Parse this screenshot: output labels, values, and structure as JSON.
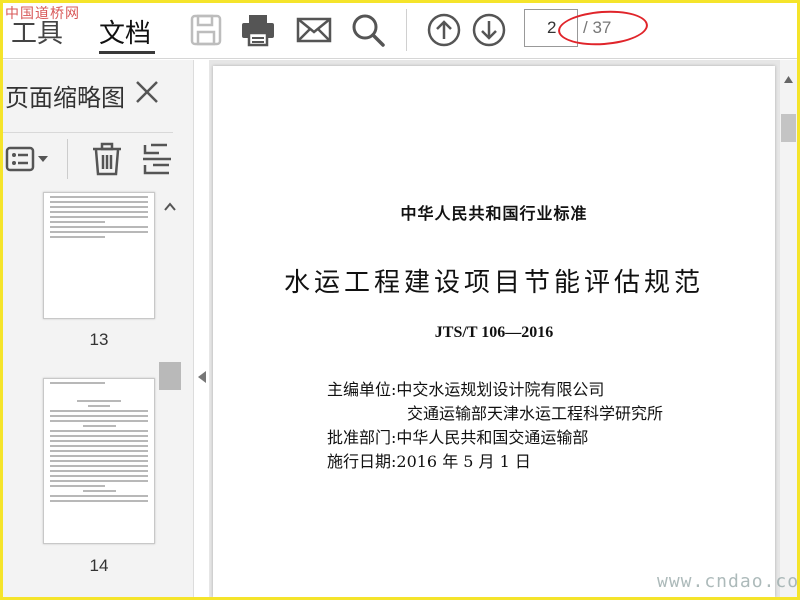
{
  "watermarks": {
    "top_left": "中国道桥网",
    "bottom_right": "www.cndao.com"
  },
  "toolbar": {
    "menu": [
      "工具",
      "文档"
    ],
    "active_menu": "文档",
    "icons": [
      "save-icon",
      "print-icon",
      "email-icon",
      "search-icon",
      "page-up-icon",
      "page-down-icon"
    ],
    "page_current": "2",
    "page_total": "/ 37"
  },
  "panel": {
    "title": "页面缩略图",
    "tools": [
      "thumbnail-options-icon",
      "delete-page-icon",
      "extract-page-icon"
    ],
    "thumbnails": [
      {
        "page": "13"
      },
      {
        "page": "14"
      }
    ]
  },
  "document": {
    "standard_type": "中华人民共和国行业标准",
    "title": "水运工程建设项目节能评估规范",
    "code": "JTS/T 106—2016",
    "info": [
      "主编单位:中交水运规划设计院有限公司",
      "交通运输部天津水运工程科学研究所",
      "批准部门:中华人民共和国交通运输部",
      "施行日期:2016 年 5 月 1 日"
    ]
  },
  "colors": {
    "highlight_ellipse": "#e0242a",
    "frame_border": "#f5e42a"
  }
}
